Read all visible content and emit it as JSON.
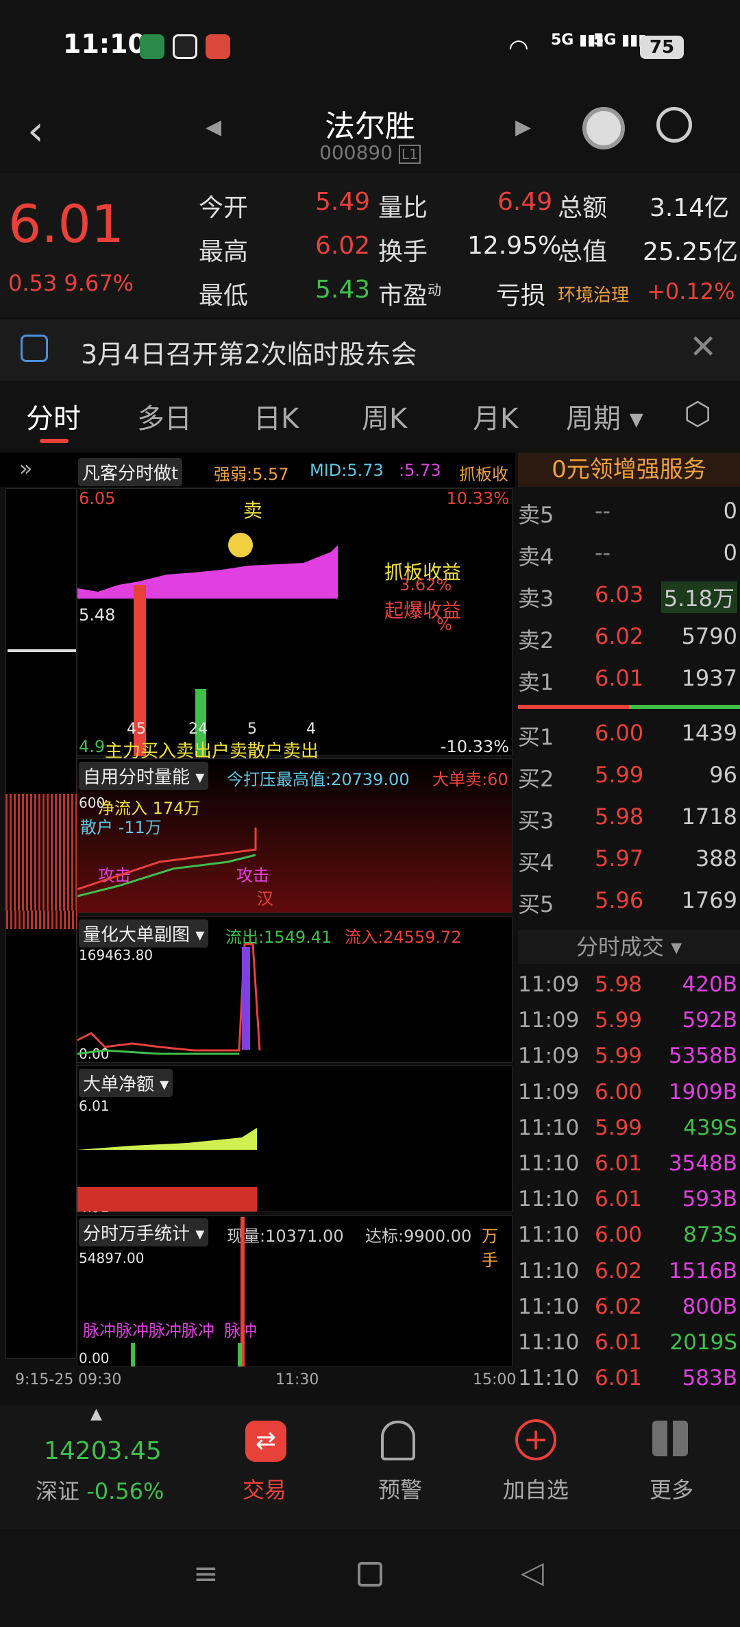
{
  "status": {
    "time": "11:10",
    "net1": "5G",
    "net2": "5G",
    "battery": "75"
  },
  "header": {
    "title": "法尔胜",
    "code": "000890",
    "level": "L1"
  },
  "quote": {
    "price": "6.01",
    "change": "0.53",
    "change_pct": "9.67%",
    "open_label": "今开",
    "open": "5.49",
    "high_label": "最高",
    "high": "6.02",
    "low_label": "最低",
    "low": "5.43",
    "vr_label": "量比",
    "vr": "6.49",
    "turnover_label": "换手",
    "turnover": "12.95%",
    "pe_label": "市盈",
    "pe_sup": "动",
    "pe": "亏损",
    "amount_label": "总额",
    "amount": "3.14亿",
    "mktcap_label": "总值",
    "mktcap": "25.25亿",
    "sector": "环境治理",
    "sector_pct": "+0.12%"
  },
  "notice": {
    "text": "3月4日召开第2次临时股东会"
  },
  "tabs": [
    "分时",
    "多日",
    "日K",
    "周K",
    "月K",
    "周期"
  ],
  "indicator_bar": {
    "name": "凡客分时做t",
    "strength": "强弱:5.57",
    "mid": "MID:5.73",
    "extra": ":5.73",
    "board": "抓板收",
    "promo": "0元领增强服务"
  },
  "main_chart": {
    "top_price": "6.05",
    "top_pct": "10.33%",
    "mid_price": "5.48",
    "bottom_price": "4.9",
    "bottom_pct": "-10.33%",
    "sell_mark": "卖",
    "board_profit_label": "抓板收益",
    "board_profit_val": "3.62%",
    "burst_profit_label": "起爆收益",
    "burst_profit_val": "%",
    "legend": "主力买入卖出户卖散户卖出",
    "bar_labels": [
      "45",
      "24",
      "5",
      "4"
    ]
  },
  "panel2": {
    "name": "自用分时量能",
    "max_label": "今打压最高值:20739.00",
    "big_sell": "大单卖:60",
    "net_inflow": "净流入 174万",
    "retail": "散户 -11万",
    "attack1": "攻击",
    "attack2": "攻击",
    "tag": "汉",
    "scale": "600"
  },
  "panel3": {
    "name": "量化大单副图",
    "outflow": "流出:1549.41",
    "inflow": "流入:24559.72",
    "top": "169463.80",
    "bottom": "0.00"
  },
  "panel4": {
    "name": "大单净额",
    "top": "6.01",
    "bottom": "4.91"
  },
  "panel5": {
    "name": "分时万手统计",
    "now": "现量:10371.00",
    "target": "达标:9900.00",
    "unit": "万手",
    "top": "54897.00",
    "bottom": "0.00",
    "pulse1": "脉冲脉冲脉冲脉冲",
    "pulse2": "脉冲"
  },
  "time_axis": [
    "9:15-25",
    "09:30",
    "11:30",
    "15:00"
  ],
  "orderbook": {
    "asks": [
      {
        "label": "卖5",
        "price": "--",
        "vol": "0"
      },
      {
        "label": "卖4",
        "price": "--",
        "vol": "0"
      },
      {
        "label": "卖3",
        "price": "6.03",
        "vol": "5.18万"
      },
      {
        "label": "卖2",
        "price": "6.02",
        "vol": "5790"
      },
      {
        "label": "卖1",
        "price": "6.01",
        "vol": "1937"
      }
    ],
    "bids": [
      {
        "label": "买1",
        "price": "6.00",
        "vol": "1439"
      },
      {
        "label": "买2",
        "price": "5.99",
        "vol": "96"
      },
      {
        "label": "买3",
        "price": "5.98",
        "vol": "1718"
      },
      {
        "label": "买4",
        "price": "5.97",
        "vol": "388"
      },
      {
        "label": "买5",
        "price": "5.96",
        "vol": "1769"
      }
    ]
  },
  "trades_title": "分时成交",
  "trades": [
    {
      "time": "11:09",
      "price": "5.98",
      "vol": "420B",
      "c": "red",
      "vc": "magenta"
    },
    {
      "time": "11:09",
      "price": "5.99",
      "vol": "592B",
      "c": "red",
      "vc": "magenta"
    },
    {
      "time": "11:09",
      "price": "5.99",
      "vol": "5358B",
      "c": "red",
      "vc": "magenta"
    },
    {
      "time": "11:09",
      "price": "6.00",
      "vol": "1909B",
      "c": "red",
      "vc": "magenta"
    },
    {
      "time": "11:10",
      "price": "5.99",
      "vol": "439S",
      "c": "red",
      "vc": "green"
    },
    {
      "time": "11:10",
      "price": "6.01",
      "vol": "3548B",
      "c": "red",
      "vc": "magenta"
    },
    {
      "time": "11:10",
      "price": "6.01",
      "vol": "593B",
      "c": "red",
      "vc": "magenta"
    },
    {
      "time": "11:10",
      "price": "6.00",
      "vol": "873S",
      "c": "red",
      "vc": "green"
    },
    {
      "time": "11:10",
      "price": "6.02",
      "vol": "1516B",
      "c": "red",
      "vc": "magenta"
    },
    {
      "time": "11:10",
      "price": "6.02",
      "vol": "800B",
      "c": "red",
      "vc": "magenta"
    },
    {
      "time": "11:10",
      "price": "6.01",
      "vol": "2019S",
      "c": "red",
      "vc": "green"
    },
    {
      "time": "11:10",
      "price": "6.01",
      "vol": "583B",
      "c": "red",
      "vc": "magenta"
    }
  ],
  "bottom": {
    "index_val": "14203.45",
    "index_name": "深证",
    "index_pct": "-0.56%",
    "nav": [
      "交易",
      "预警",
      "加自选",
      "更多"
    ]
  }
}
